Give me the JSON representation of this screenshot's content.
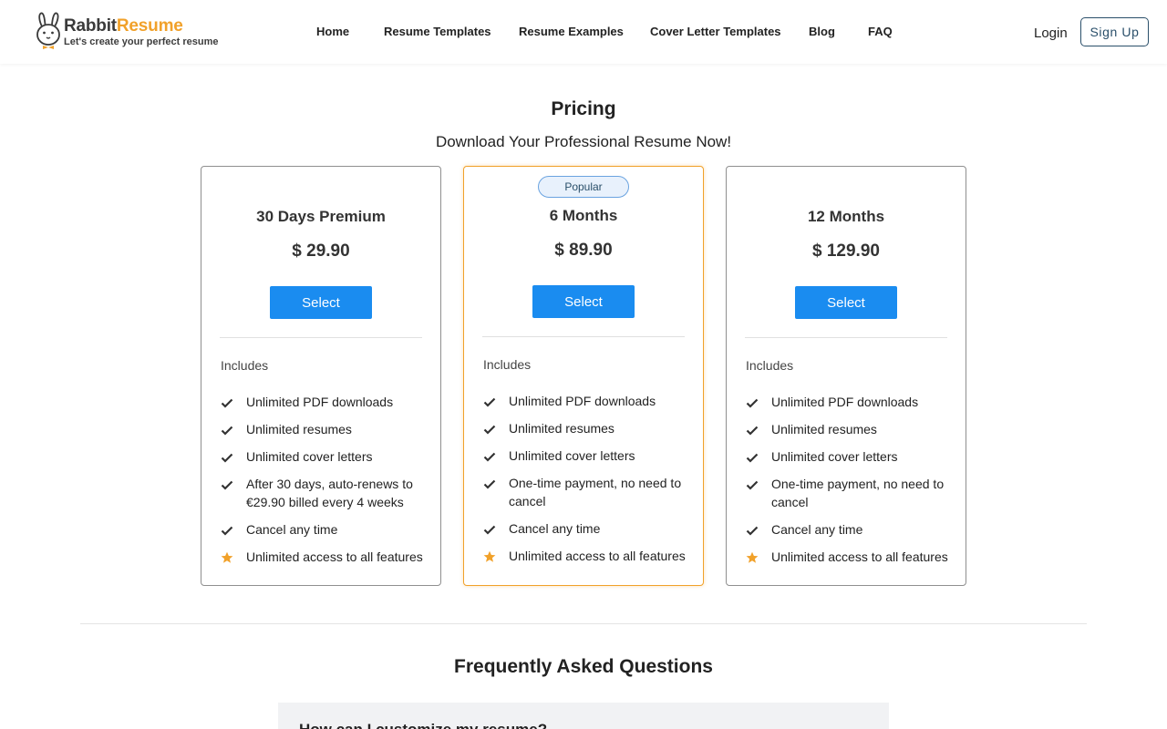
{
  "brand": {
    "name_part1": "Rabbit",
    "name_part2": "Resume",
    "tagline": "Let's create your perfect resume",
    "accent_color": "#f1a12a"
  },
  "nav": {
    "items": [
      {
        "label": "Home"
      },
      {
        "label": "Resume Templates"
      },
      {
        "label": "Resume Examples"
      },
      {
        "label": "Cover Letter Templates"
      },
      {
        "label": "Blog"
      },
      {
        "label": "FAQ"
      }
    ],
    "login_label": "Login",
    "signup_label": "Sign Up"
  },
  "pricing": {
    "title": "Pricing",
    "subtitle": "Download Your Professional Resume Now!",
    "includes_label": "Includes",
    "select_label": "Select",
    "button_color": "#1a8cf0",
    "plans": [
      {
        "name": "30 Days Premium",
        "price": "$ 29.90",
        "features": [
          {
            "icon": "check-icon",
            "text": "Unlimited PDF downloads"
          },
          {
            "icon": "check-icon",
            "text": "Unlimited resumes"
          },
          {
            "icon": "check-icon",
            "text": "Unlimited cover letters"
          },
          {
            "icon": "check-icon",
            "text": "After 30 days, auto-renews to €29.90 billed every 4 weeks"
          },
          {
            "icon": "check-icon",
            "text": "Cancel any time"
          },
          {
            "icon": "star-icon",
            "text": "Unlimited access to all features"
          }
        ]
      },
      {
        "name": "6 Months",
        "price": "$ 89.90",
        "badge": "Popular",
        "features": [
          {
            "icon": "check-icon",
            "text": "Unlimited PDF downloads"
          },
          {
            "icon": "check-icon",
            "text": "Unlimited resumes"
          },
          {
            "icon": "check-icon",
            "text": "Unlimited cover letters"
          },
          {
            "icon": "check-icon",
            "text": "One-time payment, no need to cancel"
          },
          {
            "icon": "check-icon",
            "text": "Cancel any time"
          },
          {
            "icon": "star-icon",
            "text": "Unlimited access to all features"
          }
        ]
      },
      {
        "name": "12 Months",
        "price": "$ 129.90",
        "features": [
          {
            "icon": "check-icon",
            "text": "Unlimited PDF downloads"
          },
          {
            "icon": "check-icon",
            "text": "Unlimited resumes"
          },
          {
            "icon": "check-icon",
            "text": "Unlimited cover letters"
          },
          {
            "icon": "check-icon",
            "text": "One-time payment, no need to cancel"
          },
          {
            "icon": "check-icon",
            "text": "Cancel any time"
          },
          {
            "icon": "star-icon",
            "text": "Unlimited access to all features"
          }
        ]
      }
    ]
  },
  "faq": {
    "title": "Frequently Asked Questions",
    "items": [
      {
        "question": "How can I customize my resume?"
      }
    ]
  }
}
